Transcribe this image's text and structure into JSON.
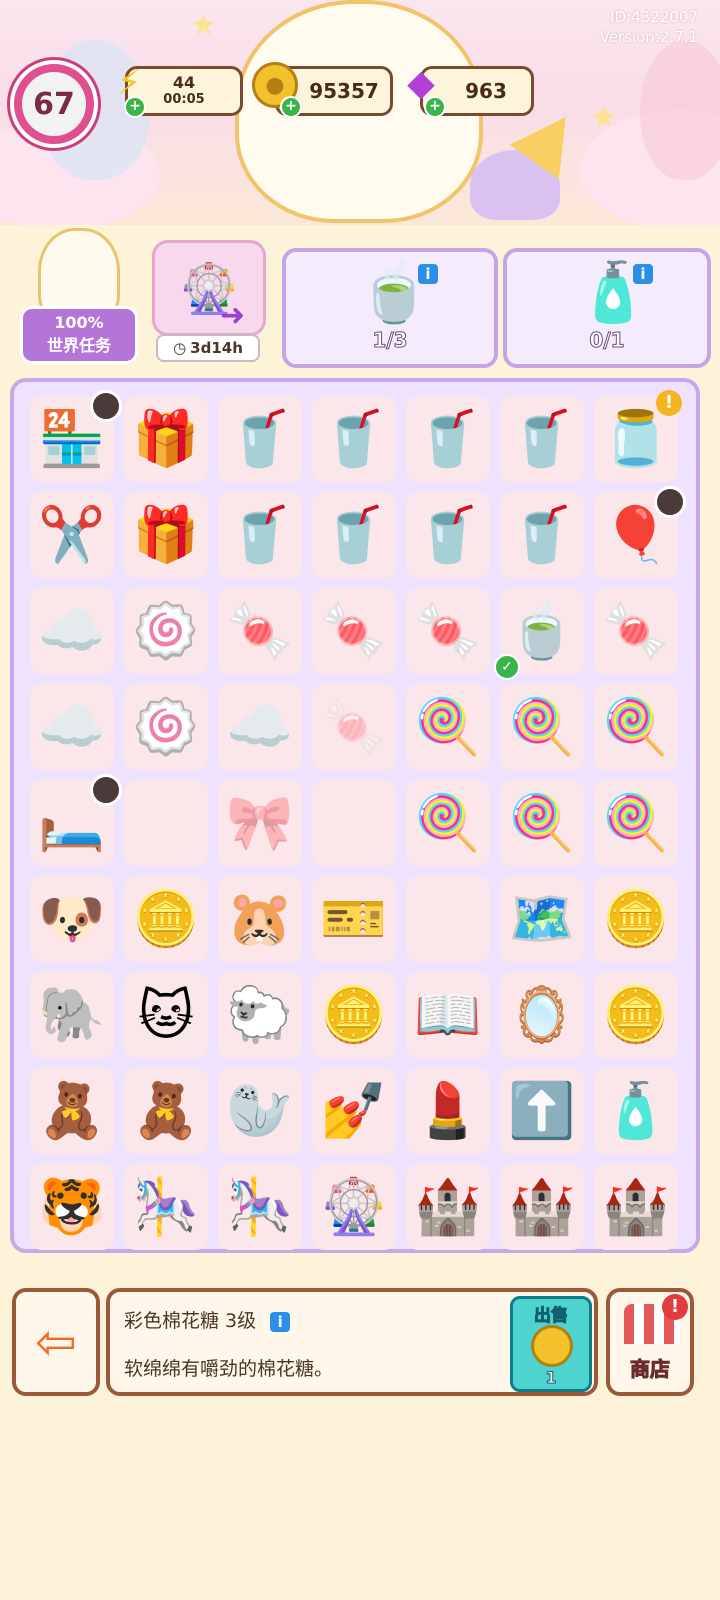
{
  "meta": {
    "id_label": "ID:4322007",
    "version_label": "Version:2.7.1"
  },
  "header": {
    "level": "67",
    "energy": {
      "value": "44",
      "timer": "00:05"
    },
    "coins": "95357",
    "gems": "963"
  },
  "quests": {
    "world_task": {
      "progress": "100%",
      "label": "世界任务"
    },
    "event": {
      "timer": "3d14h"
    },
    "orders": [
      {
        "progress": "1/3",
        "icon": "matcha-drink-icon"
      },
      {
        "progress": "0/1",
        "icon": "bow-bottle-icon"
      }
    ]
  },
  "board": {
    "rows": [
      [
        {
          "glyph": "🏪",
          "name": "candy-shop",
          "badge": "clock"
        },
        {
          "glyph": "🎁",
          "name": "gift-box"
        },
        {
          "glyph": "🥤",
          "name": "strawberry-drink"
        },
        {
          "glyph": "🥤",
          "name": "strawberry-drink"
        },
        {
          "glyph": "🥤",
          "name": "strawberry-drink"
        },
        {
          "glyph": "🥤",
          "name": "strawberry-drink"
        },
        {
          "glyph": "🫙",
          "name": "glass-jar",
          "badge": "warn"
        }
      ],
      [
        {
          "glyph": "✂️",
          "name": "paper-scissors"
        },
        {
          "glyph": "🎁",
          "name": "glowing-gift"
        },
        {
          "glyph": "🥤",
          "name": "strawberry-drink"
        },
        {
          "glyph": "🥤",
          "name": "strawberry-drink"
        },
        {
          "glyph": "🥤",
          "name": "strawberry-drink"
        },
        {
          "glyph": "🥤",
          "name": "strawberry-drink"
        },
        {
          "glyph": "🎈",
          "name": "balloon-gift",
          "badge": "clock"
        }
      ],
      [
        {
          "glyph": "☁️",
          "name": "rainbow-cotton-candy"
        },
        {
          "glyph": "🍥",
          "name": "marshmallow"
        },
        {
          "glyph": "🍬",
          "name": "twist-marshmallow"
        },
        {
          "glyph": "🍬",
          "name": "green-candy"
        },
        {
          "glyph": "🍬",
          "name": "green-candy"
        },
        {
          "glyph": "🍵",
          "name": "matcha-drink",
          "badge": "check"
        },
        {
          "glyph": "🍬",
          "name": "twist-marshmallow"
        }
      ],
      [
        {
          "glyph": "☁️",
          "name": "rainbow-cotton-candy"
        },
        {
          "glyph": "🍥",
          "name": "marshmallow"
        },
        {
          "glyph": "☁️",
          "name": "rainbow-cotton-candy"
        },
        {
          "glyph": "🍬",
          "name": "green-candy-faded"
        },
        {
          "glyph": "🍭",
          "name": "green-lollipop"
        },
        {
          "glyph": "🍭",
          "name": "swirl-lollipop"
        },
        {
          "glyph": "🍭",
          "name": "swirl-lollipop"
        }
      ],
      [
        {
          "glyph": "🛏️",
          "name": "pink-bed",
          "badge": "clock"
        },
        {
          "glyph": "",
          "name": "empty-cell"
        },
        {
          "glyph": "🎀",
          "name": "locked-bow"
        },
        {
          "glyph": "",
          "name": "empty-cell"
        },
        {
          "glyph": "🍭",
          "name": "green-lollipop"
        },
        {
          "glyph": "🍭",
          "name": "swirl-lollipop"
        },
        {
          "glyph": "🍭",
          "name": "swirl-lollipop"
        }
      ],
      [
        {
          "glyph": "🐶",
          "name": "puppy-plush"
        },
        {
          "glyph": "🪙",
          "name": "gold-coin"
        },
        {
          "glyph": "🐹",
          "name": "hamster-plush"
        },
        {
          "glyph": "🎫",
          "name": "ticket"
        },
        {
          "glyph": "",
          "name": "empty-cell"
        },
        {
          "glyph": "🗺️",
          "name": "map"
        },
        {
          "glyph": "🪙",
          "name": "coin-pile"
        }
      ],
      [
        {
          "glyph": "🐘",
          "name": "elephant-plush"
        },
        {
          "glyph": "🐱",
          "name": "cat-plush"
        },
        {
          "glyph": "🐑",
          "name": "sheep-plush"
        },
        {
          "glyph": "🪙",
          "name": "coin-stack"
        },
        {
          "glyph": "📖",
          "name": "storybook"
        },
        {
          "glyph": "🪞",
          "name": "hand-mirror"
        },
        {
          "glyph": "🪙",
          "name": "coin-heap"
        }
      ],
      [
        {
          "glyph": "🧸",
          "name": "teddy-bear"
        },
        {
          "glyph": "🧸",
          "name": "purple-bear"
        },
        {
          "glyph": "🦭",
          "name": "seal-plush"
        },
        {
          "glyph": "💅",
          "name": "nail-polish"
        },
        {
          "glyph": "💄",
          "name": "lipstick"
        },
        {
          "glyph": "⬆️",
          "name": "upgrade-card"
        },
        {
          "glyph": "🧴",
          "name": "makeup-palette"
        }
      ],
      [
        {
          "glyph": "🐯",
          "name": "tiger-plush"
        },
        {
          "glyph": "🎠",
          "name": "carousel"
        },
        {
          "glyph": "🎠",
          "name": "carousel"
        },
        {
          "glyph": "🎡",
          "name": "ferris-wheel"
        },
        {
          "glyph": "🏰",
          "name": "pink-castle"
        },
        {
          "glyph": "🏰",
          "name": "pink-castle"
        },
        {
          "glyph": "🏰",
          "name": "pink-castle"
        }
      ]
    ]
  },
  "selected_item": {
    "title": "彩色棉花糖 3级",
    "description": "软绵绵有嚼劲的棉花糖。",
    "sell_label": "出售",
    "sell_price": "1"
  },
  "shop_label": "商店",
  "colors": {
    "accent": "#e04f8f",
    "board_border": "#c6a9ea",
    "frame_brown": "#9a5a3a",
    "sell_teal": "#4fd3d1"
  }
}
